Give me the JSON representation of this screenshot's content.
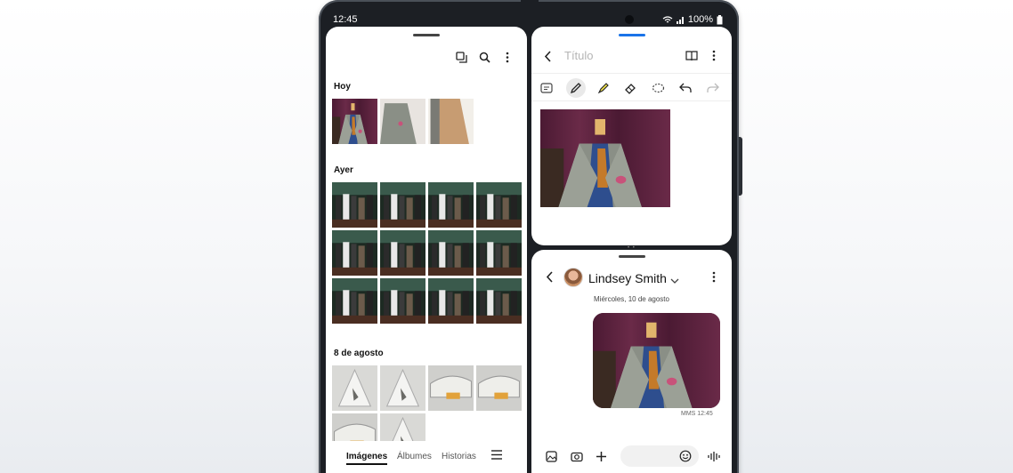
{
  "status": {
    "time": "12:45",
    "battery": "100%"
  },
  "gallery": {
    "sections": [
      {
        "title": "Hoy"
      },
      {
        "title": "Ayer"
      },
      {
        "title": "8 de agosto"
      }
    ],
    "tabs": [
      "Imágenes",
      "Álbumes",
      "Historias"
    ]
  },
  "notes": {
    "title_placeholder": "Título"
  },
  "messages": {
    "contact_name": "Lindsey Smith",
    "date_label": "Miércoles, 10 de agosto",
    "meta": "MMS 12:45"
  },
  "icons": [
    "copy-icon",
    "search-icon",
    "more-icon",
    "back-icon",
    "book-icon",
    "text-icon",
    "pen-icon",
    "highlighter-icon",
    "eraser-icon",
    "lasso-icon",
    "undo-icon",
    "redo-icon",
    "chevron-down-icon",
    "gallery-icon",
    "camera-icon",
    "plus-icon",
    "emoji-icon",
    "voice-icon",
    "menu-icon"
  ],
  "colors": {
    "accent": "#1a73e8",
    "suit": "#8a8f86",
    "curtain": "#5a2440"
  }
}
